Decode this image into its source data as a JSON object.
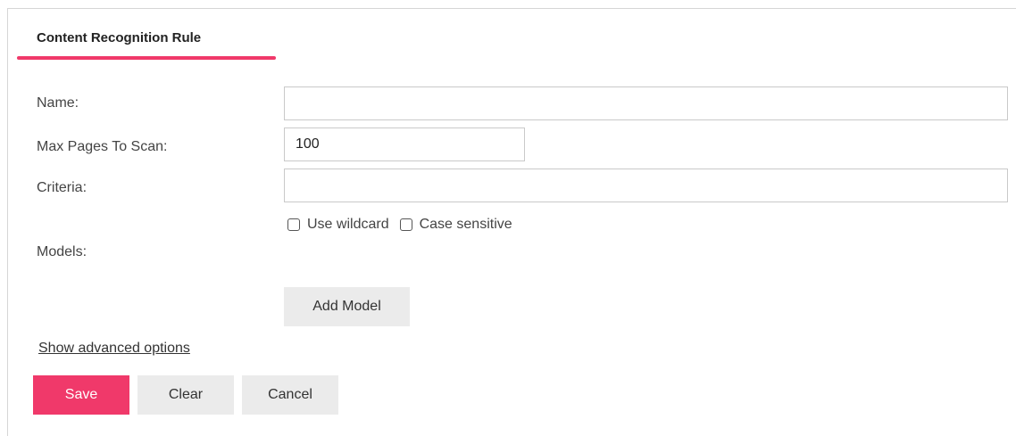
{
  "form": {
    "tab_title": "Content Recognition Rule",
    "name": {
      "label": "Name:",
      "value": ""
    },
    "max_pages": {
      "label": "Max Pages To Scan:",
      "value": "100"
    },
    "criteria": {
      "label": "Criteria:",
      "value": ""
    },
    "use_wildcard_label": "Use wildcard",
    "case_sensitive_label": "Case sensitive",
    "models_label": "Models:",
    "add_model_label": "Add Model",
    "advanced_link": "Show advanced options"
  },
  "actions": {
    "save_label": "Save",
    "clear_label": "Clear",
    "cancel_label": "Cancel"
  },
  "colors": {
    "accent": "#f0396a",
    "button_grey": "#ebebeb",
    "border": "#c9c9c9"
  }
}
